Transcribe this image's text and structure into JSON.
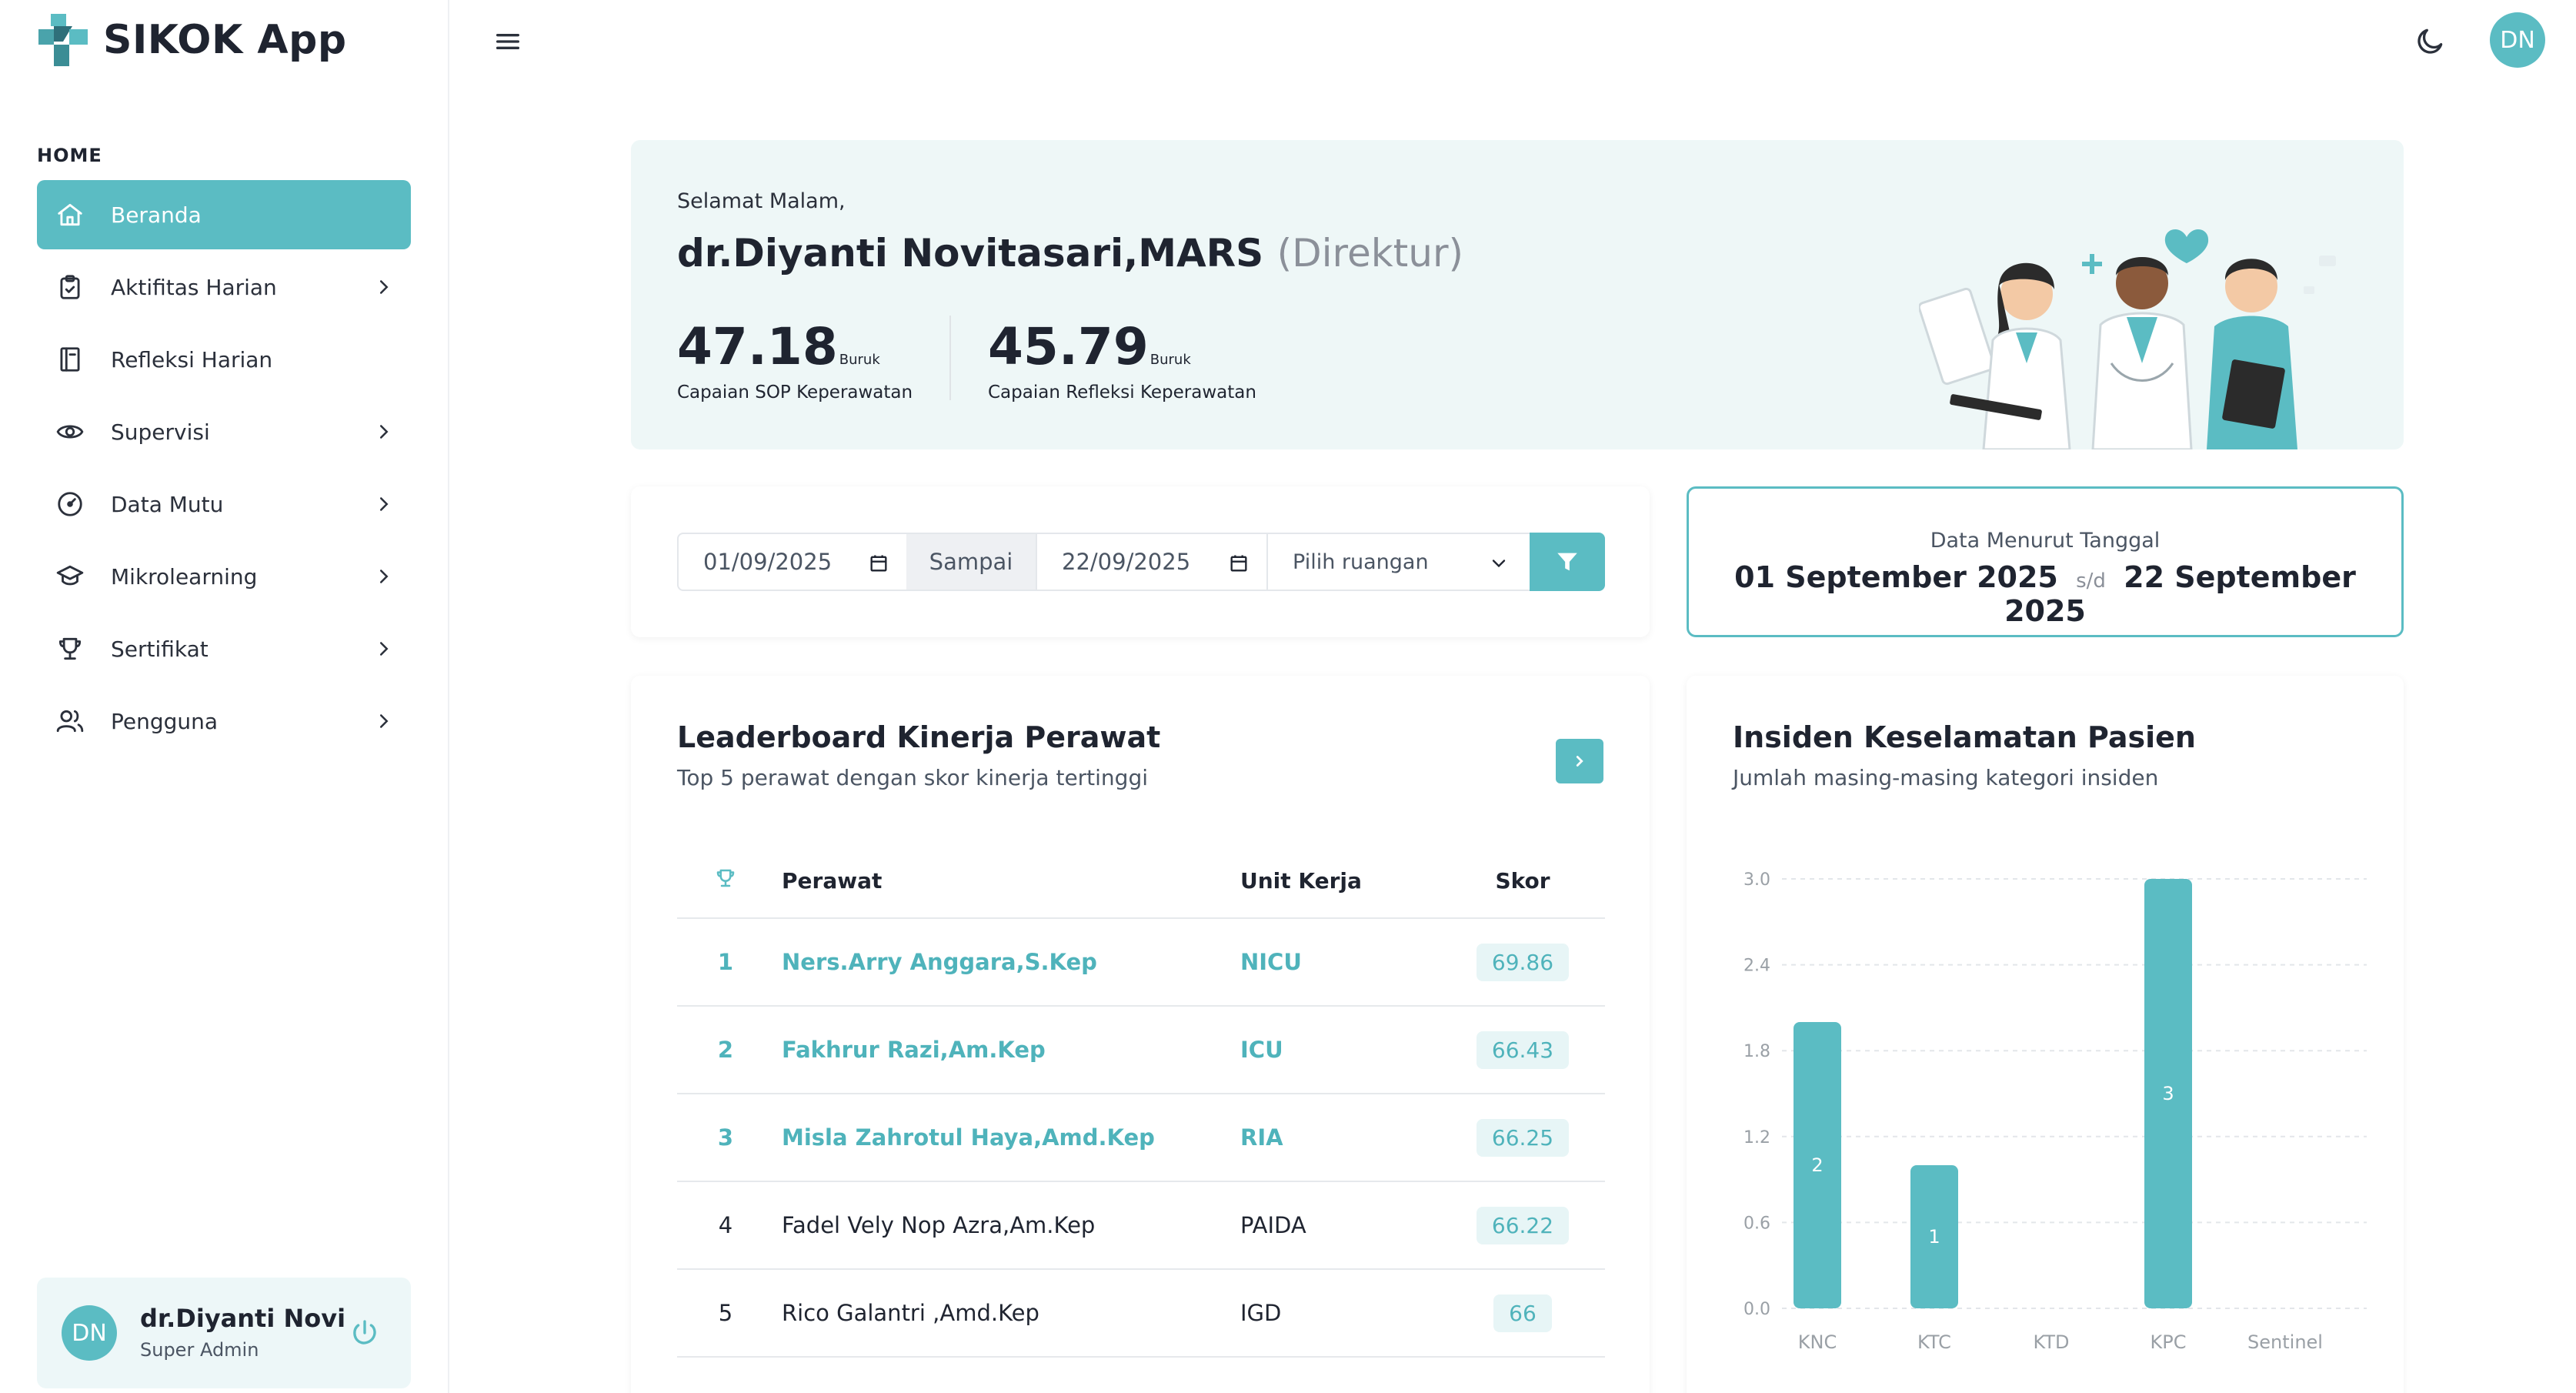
{
  "app": {
    "title": "SIKOK App"
  },
  "sidebar": {
    "section": "HOME",
    "items": [
      {
        "label": "Beranda",
        "icon": "home-icon",
        "active": true,
        "has_children": false
      },
      {
        "label": "Aktifitas Harian",
        "icon": "clipboard-icon",
        "active": false,
        "has_children": true
      },
      {
        "label": "Refleksi Harian",
        "icon": "book-icon",
        "active": false,
        "has_children": false
      },
      {
        "label": "Supervisi",
        "icon": "eye-icon",
        "active": false,
        "has_children": true
      },
      {
        "label": "Data Mutu",
        "icon": "gauge-icon",
        "active": false,
        "has_children": true
      },
      {
        "label": "Mikrolearning",
        "icon": "graduation-cap-icon",
        "active": false,
        "has_children": true
      },
      {
        "label": "Sertifikat",
        "icon": "trophy-icon",
        "active": false,
        "has_children": true
      },
      {
        "label": "Pengguna",
        "icon": "users-icon",
        "active": false,
        "has_children": true
      }
    ],
    "user": {
      "initials": "DN",
      "name": "dr.Diyanti Novi",
      "role": "Super Admin"
    }
  },
  "topbar": {
    "avatar_initials": "DN"
  },
  "welcome": {
    "greeting": "Selamat Malam,",
    "name": "dr.Diyanti Novitasari,MARS",
    "role": "(Direktur)",
    "stats": [
      {
        "value": "47.18",
        "quality": "Buruk",
        "caption": "Capaian SOP Keperawatan"
      },
      {
        "value": "45.79",
        "quality": "Buruk",
        "caption": "Capaian Refleksi Keperawatan"
      }
    ]
  },
  "filter": {
    "date_from": "01/09/2025",
    "between_label": "Sampai",
    "date_to": "22/09/2025",
    "room_placeholder": "Pilih ruangan"
  },
  "date_card": {
    "label": "Data Menurut Tanggal",
    "from": "01 September 2025",
    "separator": "s/d",
    "to": "22 September 2025"
  },
  "leaderboard": {
    "title": "Leaderboard Kinerja Perawat",
    "subtitle": "Top 5 perawat dengan skor kinerja tertinggi",
    "columns": {
      "nurse": "Perawat",
      "unit": "Unit Kerja",
      "score": "Skor"
    },
    "rows": [
      {
        "rank": "1",
        "name": "Ners.Arry Anggara,S.Kep",
        "unit": "NICU",
        "score": "69.86"
      },
      {
        "rank": "2",
        "name": "Fakhrur Razi,Am.Kep",
        "unit": "ICU",
        "score": "66.43"
      },
      {
        "rank": "3",
        "name": "Misla Zahrotul Haya,Amd.Kep",
        "unit": "RIA",
        "score": "66.25"
      },
      {
        "rank": "4",
        "name": "Fadel Vely Nop Azra,Am.Kep",
        "unit": "PAIDA",
        "score": "66.22"
      },
      {
        "rank": "5",
        "name": "Rico Galantri ,Amd.Kep",
        "unit": "IGD",
        "score": "66"
      }
    ]
  },
  "incident": {
    "title": "Insiden Keselamatan Pasien",
    "subtitle": "Jumlah masing-masing kategori insiden"
  },
  "chart_data": {
    "type": "bar",
    "categories": [
      "KNC",
      "KTC",
      "KTD",
      "KPC",
      "Sentinel"
    ],
    "values": [
      2,
      1,
      0,
      3,
      0
    ],
    "ylim": [
      0,
      3.0
    ],
    "yticks": [
      "0.0",
      "0.6",
      "1.2",
      "1.8",
      "2.4",
      "3.0"
    ],
    "grid": true,
    "bar_color": "#5bbcc3"
  },
  "colors": {
    "accent": "#5bbcc3",
    "banner": "#eef7f7"
  }
}
